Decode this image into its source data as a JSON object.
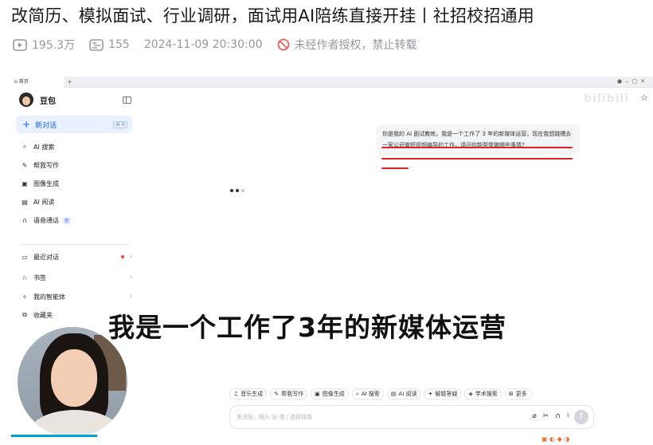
{
  "video": {
    "title": "改简历、模拟面试、行业调研，面试用AI陪练直接开挂丨社招校招通用",
    "views": "195.3万",
    "danmaku": "155",
    "datetime": "2024-11-09 20:30:00",
    "license": "未经作者授权，禁止转载",
    "subtitle": "我是一个工作了3年的新媒体运营",
    "watermark": "bilibili"
  },
  "app": {
    "tab_title": "首页",
    "brand": "豆包",
    "new_chat": "新对话",
    "nav": [
      {
        "label": "AI 搜索",
        "icon": "search-icon"
      },
      {
        "label": "帮我写作",
        "icon": "pen-icon"
      },
      {
        "label": "图像生成",
        "icon": "image-icon"
      },
      {
        "label": "AI 阅读",
        "icon": "book-icon"
      },
      {
        "label": "语音通话",
        "icon": "headphone-icon",
        "badge": "新"
      }
    ],
    "nav2": [
      {
        "label": "最近对话",
        "icon": "chat-icon"
      },
      {
        "label": "书签",
        "icon": "star-icon"
      },
      {
        "label": "我的智能体",
        "icon": "sparkle-icon"
      },
      {
        "label": "收藏夹",
        "icon": "bookmark-icon"
      }
    ],
    "message": "你是我的 AI 面试教练，我是一个工作了 3 年的新媒体运营，现在我想跳槽去一家公司做短视频编导的工作，请问你能帮我做哪些事情?",
    "tools": [
      {
        "label": "音乐生成",
        "icon": "♫"
      },
      {
        "label": "帮我写作",
        "icon": "✎"
      },
      {
        "label": "图像生成",
        "icon": "▣"
      },
      {
        "label": "AI 搜索",
        "icon": "⌕"
      },
      {
        "label": "AI 阅读",
        "icon": "▤"
      },
      {
        "label": "解题答疑",
        "icon": "✦"
      },
      {
        "label": "学术搜索",
        "icon": "◈"
      },
      {
        "label": "更多",
        "icon": "⊞"
      }
    ],
    "input_placeholder": "发消息，输入 @ 或 / 选择技能"
  },
  "colors": {
    "accent": "#1a5cff",
    "underline": "#d9232d",
    "progress": "#00a1d6"
  }
}
